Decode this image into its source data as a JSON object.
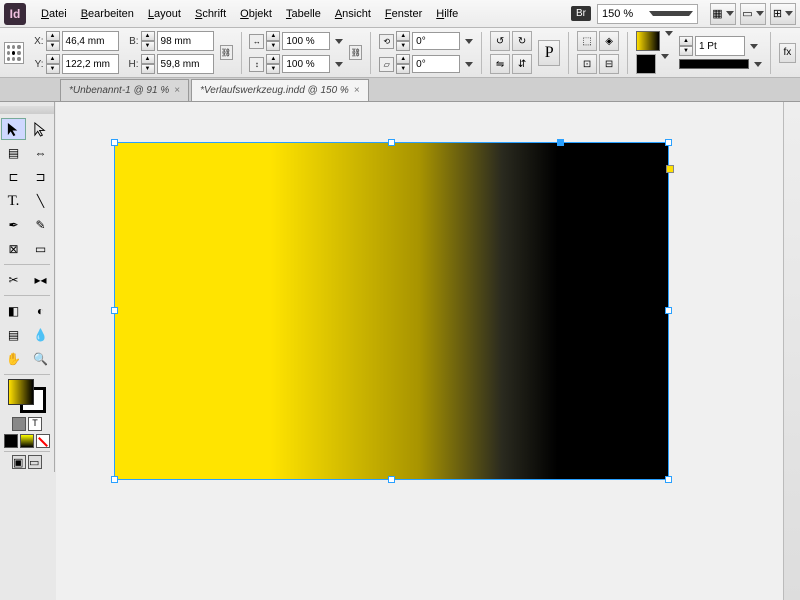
{
  "app": {
    "icon_label": "Id"
  },
  "menu": {
    "datei": "Datei",
    "bearbeiten": "Bearbeiten",
    "layout": "Layout",
    "schrift": "Schrift",
    "objekt": "Objekt",
    "tabelle": "Tabelle",
    "ansicht": "Ansicht",
    "fenster": "Fenster",
    "hilfe": "Hilfe",
    "bridge": "Br",
    "zoom": "150 %"
  },
  "control": {
    "x_label": "X:",
    "x_value": "46,4 mm",
    "y_label": "Y:",
    "y_value": "122,2 mm",
    "w_label": "B:",
    "w_value": "98 mm",
    "h_label": "H:",
    "h_value": "59,8 mm",
    "scale_x": "100 %",
    "scale_y": "100 %",
    "rotate": "0°",
    "shear": "0°",
    "stroke_weight": "1 Pt",
    "p_char": "P"
  },
  "tabs": [
    {
      "title": "*Unbenannt-1 @ 91 %",
      "active": false
    },
    {
      "title": "*Verlaufswerkzeug.indd @ 150 %",
      "active": true
    }
  ],
  "tools": {
    "selection": "selection",
    "direct": "direct-selection",
    "page": "page",
    "gap": "gap",
    "type": "type",
    "line": "line",
    "pen": "pen",
    "pencil": "pencil",
    "frame": "frame",
    "rect": "rectangle",
    "scissors": "scissors",
    "transform": "free-transform",
    "gradient_swatch": "gradient-swatch",
    "eyedropper": "eyedropper",
    "hand": "hand",
    "zoom": "zoom",
    "note": "note",
    "gradient": "gradient-feather"
  }
}
